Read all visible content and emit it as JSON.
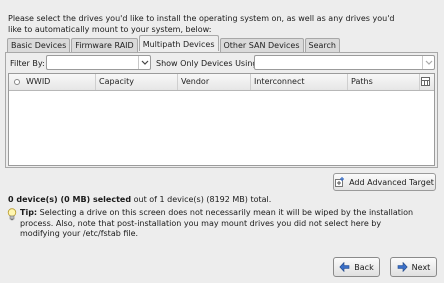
{
  "intro_text": "Please select the drives you'd like to install the operating system on, as well as any drives you'd like to automatically mount to your system, below:",
  "tabs": [
    {
      "label": "Basic Devices",
      "active": false
    },
    {
      "label": "Firmware RAID",
      "active": false
    },
    {
      "label": "Multipath Devices",
      "active": true
    },
    {
      "label": "Other SAN Devices",
      "active": false
    },
    {
      "label": "Search",
      "active": false
    }
  ],
  "filter": {
    "filter_by_label": "Filter By:",
    "filter_by_value": "",
    "show_only_label": "Show Only Devices Using:",
    "show_only_value": ""
  },
  "table": {
    "columns": [
      "WWID",
      "Capacity",
      "Vendor",
      "Interconnect",
      "Paths"
    ],
    "rows": []
  },
  "add_target_button": "Add Advanced Target",
  "summary": {
    "selected": "0 device(s) (0 MB) selected",
    "rest": " out of 1 device(s) (8192 MB) total."
  },
  "tip": {
    "label": "Tip:",
    "text": " Selecting a drive on this screen does not necessarily mean it will be wiped by the installation process.  Also, note that post-installation you may mount drives you did not select here by modifying your /etc/fstab file."
  },
  "buttons": {
    "back": "Back",
    "next": "Next"
  },
  "icons": {
    "add_target": "add-target-icon",
    "tip": "lightbulb-icon",
    "back": "back-arrow-icon",
    "next": "next-arrow-icon",
    "column_picker": "column-picker-icon"
  },
  "colors": {
    "accent_blue": "#3a6fc7"
  }
}
